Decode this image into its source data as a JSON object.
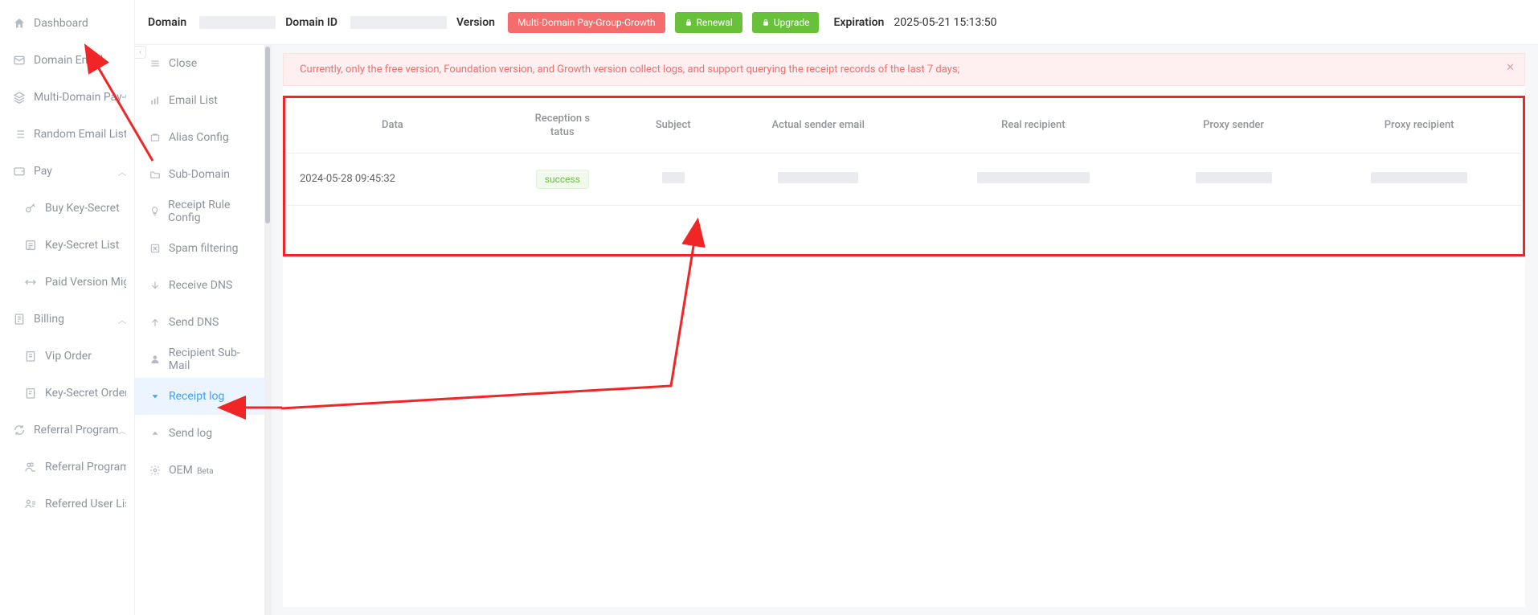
{
  "sidebarLeft": [
    {
      "key": "dashboard",
      "label": "Dashboard",
      "icon": "home"
    },
    {
      "key": "domain-email",
      "label": "Domain Email",
      "icon": "mail"
    },
    {
      "key": "multi-domain",
      "label": "Multi-Domain Pay-Group",
      "icon": "layers"
    },
    {
      "key": "random-email",
      "label": "Random Email List",
      "icon": "list"
    },
    {
      "key": "pay",
      "label": "Pay",
      "icon": "wallet",
      "expandable": true
    },
    {
      "key": "buy-key",
      "label": "Buy Key-Secret",
      "icon": "key",
      "sub": true
    },
    {
      "key": "key-list",
      "label": "Key-Secret List",
      "icon": "list2",
      "sub": true
    },
    {
      "key": "paid-migration",
      "label": "Paid Version Migration",
      "icon": "swap",
      "sub": true
    },
    {
      "key": "billing",
      "label": "Billing",
      "icon": "bill",
      "expandable": true
    },
    {
      "key": "vip-order",
      "label": "Vip Order",
      "icon": "order",
      "sub": true
    },
    {
      "key": "ks-order",
      "label": "Key-Secret Order",
      "icon": "order2",
      "sub": true
    },
    {
      "key": "referral",
      "label": "Referral Program",
      "icon": "refresh",
      "expandable": true
    },
    {
      "key": "referral-prog",
      "label": "Referral Program",
      "icon": "users",
      "sub": true
    },
    {
      "key": "referred-users",
      "label": "Referred User List",
      "icon": "userlist",
      "sub": true
    }
  ],
  "header": {
    "domain_label": "Domain",
    "domain_id_label": "Domain ID",
    "version_label": "Version",
    "version_tag": "Multi-Domain Pay-Group-Growth",
    "renewal_label": "Renewal",
    "upgrade_label": "Upgrade",
    "expiration_label": "Expiration",
    "expiration_value": "2025-05-21 15:13:50"
  },
  "sidebarMid": [
    {
      "key": "close",
      "label": "Close",
      "icon": "menu"
    },
    {
      "key": "email-list",
      "label": "Email List",
      "icon": "bars"
    },
    {
      "key": "alias",
      "label": "Alias Config",
      "icon": "alias"
    },
    {
      "key": "subdomain",
      "label": "Sub-Domain",
      "icon": "folder"
    },
    {
      "key": "rule",
      "label": "Receipt Rule Config",
      "icon": "bulb"
    },
    {
      "key": "spam",
      "label": "Spam filtering",
      "icon": "ban"
    },
    {
      "key": "recvdns",
      "label": "Receive DNS",
      "icon": "down"
    },
    {
      "key": "senddns",
      "label": "Send DNS",
      "icon": "up"
    },
    {
      "key": "submail",
      "label": "Recipient Sub-Mail",
      "icon": "user"
    },
    {
      "key": "receiptlog",
      "label": "Receipt log",
      "icon": "caret-down",
      "active": true
    },
    {
      "key": "sendlog",
      "label": "Send log",
      "icon": "caret-up"
    },
    {
      "key": "oem",
      "label": "OEM",
      "icon": "gear",
      "badge": "Beta"
    }
  ],
  "alert": {
    "text": "Currently, only the free version, Foundation version, and Growth version collect logs, and support querying the receipt records of the last 7 days;"
  },
  "table": {
    "columns": [
      "Data",
      "Reception s\ntatus",
      "Subject",
      "Actual sender email",
      "Real recipient",
      "Proxy sender",
      "Proxy recipient"
    ],
    "rows": [
      {
        "data": "2024-05-28 09:45:32",
        "status": "success"
      }
    ]
  }
}
